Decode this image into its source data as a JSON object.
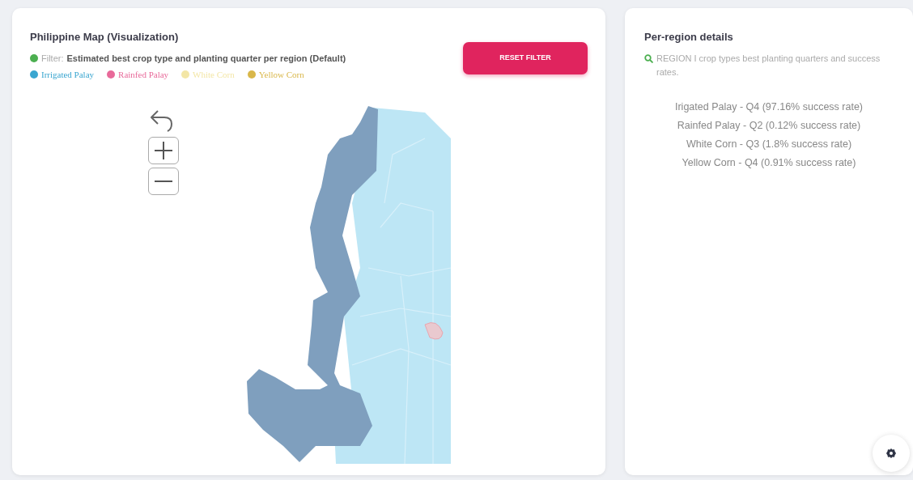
{
  "map_panel": {
    "title": "Philippine Map (Visualization)",
    "filter": {
      "label": "Filter:",
      "text": "Estimated best crop type and planting quarter per region (Default)",
      "color": "#4caf50"
    },
    "legend": [
      {
        "label": "Irrigated Palay",
        "color": "#3aa6d0"
      },
      {
        "label": "Rainfed Palay",
        "color": "#e86a9a"
      },
      {
        "label": "White Corn",
        "color": "#f3e6a6"
      },
      {
        "label": "Yellow Corn",
        "color": "#d9b74a"
      }
    ],
    "reset_button": "RESET FILTER"
  },
  "details_panel": {
    "title": "Per-region details",
    "subtitle": "REGION I crop types best planting quarters and success rates.",
    "lines": [
      "Irigated Palay - Q4 (97.16% success rate)",
      "Rainfed Palay - Q2 (0.12% success rate)",
      "White Corn - Q3 (1.8% success rate)",
      "Yellow Corn - Q4 (0.91% success rate)"
    ]
  }
}
